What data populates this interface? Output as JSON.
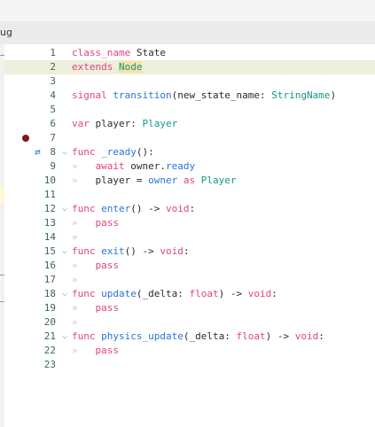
{
  "tab": {
    "label": "ug"
  },
  "lines": [
    {
      "n": "1",
      "segs": [
        [
          "kw",
          "class_name"
        ],
        [
          "pl",
          " State"
        ]
      ]
    },
    {
      "n": "2",
      "segs": [
        [
          "kw",
          "extends"
        ],
        [
          "pl",
          " "
        ],
        [
          "ty",
          "Node"
        ]
      ],
      "highlight": true
    },
    {
      "n": "3",
      "segs": []
    },
    {
      "n": "4",
      "segs": [
        [
          "kw",
          "signal"
        ],
        [
          "pl",
          " "
        ],
        [
          "fn",
          "transition"
        ],
        [
          "pl",
          "(new_state_name: "
        ],
        [
          "ty",
          "StringName"
        ],
        [
          "pl",
          ")"
        ]
      ]
    },
    {
      "n": "5",
      "segs": []
    },
    {
      "n": "6",
      "segs": [
        [
          "kw",
          "var"
        ],
        [
          "pl",
          " player: "
        ],
        [
          "ty",
          "Player"
        ]
      ]
    },
    {
      "n": "7",
      "segs": [],
      "breakpoint": true
    },
    {
      "n": "8",
      "segs": [
        [
          "kw",
          "func"
        ],
        [
          "pl",
          " "
        ],
        [
          "fn",
          "_ready"
        ],
        [
          "pl",
          "():"
        ]
      ],
      "fold": true,
      "signal": true
    },
    {
      "n": "9",
      "segs": [
        [
          "tab",
          "»   "
        ],
        [
          "kw",
          "await"
        ],
        [
          "pl",
          " owner."
        ],
        [
          "fn",
          "ready"
        ]
      ]
    },
    {
      "n": "10",
      "segs": [
        [
          "tab",
          "»   "
        ],
        [
          "pl",
          "player = "
        ],
        [
          "fn",
          "owner"
        ],
        [
          "pl",
          " "
        ],
        [
          "kw",
          "as"
        ],
        [
          "pl",
          " "
        ],
        [
          "ty",
          "Player"
        ]
      ]
    },
    {
      "n": "11",
      "segs": []
    },
    {
      "n": "12",
      "segs": [
        [
          "kw",
          "func"
        ],
        [
          "pl",
          " "
        ],
        [
          "fn",
          "enter"
        ],
        [
          "pl",
          "() -> "
        ],
        [
          "kw",
          "void"
        ],
        [
          "pl",
          ":"
        ]
      ],
      "fold": true
    },
    {
      "n": "13",
      "segs": [
        [
          "tab",
          "»   "
        ],
        [
          "kw",
          "pass"
        ]
      ]
    },
    {
      "n": "14",
      "segs": [
        [
          "tab",
          "»"
        ]
      ]
    },
    {
      "n": "15",
      "segs": [
        [
          "kw",
          "func"
        ],
        [
          "pl",
          " "
        ],
        [
          "fn",
          "exit"
        ],
        [
          "pl",
          "() -> "
        ],
        [
          "kw",
          "void"
        ],
        [
          "pl",
          ":"
        ]
      ],
      "fold": true
    },
    {
      "n": "16",
      "segs": [
        [
          "tab",
          "»   "
        ],
        [
          "kw",
          "pass"
        ]
      ]
    },
    {
      "n": "17",
      "segs": [
        [
          "tab",
          "»"
        ]
      ]
    },
    {
      "n": "18",
      "segs": [
        [
          "kw",
          "func"
        ],
        [
          "pl",
          " "
        ],
        [
          "fn",
          "update"
        ],
        [
          "pl",
          "(_delta: "
        ],
        [
          "kw",
          "float"
        ],
        [
          "pl",
          ") -> "
        ],
        [
          "kw",
          "void"
        ],
        [
          "pl",
          ":"
        ]
      ],
      "fold": true
    },
    {
      "n": "19",
      "segs": [
        [
          "tab",
          "»   "
        ],
        [
          "kw",
          "pass"
        ]
      ]
    },
    {
      "n": "20",
      "segs": [
        [
          "tab",
          "»"
        ]
      ]
    },
    {
      "n": "21",
      "segs": [
        [
          "kw",
          "func"
        ],
        [
          "pl",
          " "
        ],
        [
          "fn",
          "physics_update"
        ],
        [
          "pl",
          "(_delta: "
        ],
        [
          "kw",
          "float"
        ],
        [
          "pl",
          ") -> "
        ],
        [
          "kw",
          "void"
        ],
        [
          "pl",
          ":"
        ]
      ],
      "fold": true
    },
    {
      "n": "22",
      "segs": [
        [
          "tab",
          "»   "
        ],
        [
          "kw",
          "pass"
        ]
      ]
    },
    {
      "n": "23",
      "segs": []
    }
  ]
}
